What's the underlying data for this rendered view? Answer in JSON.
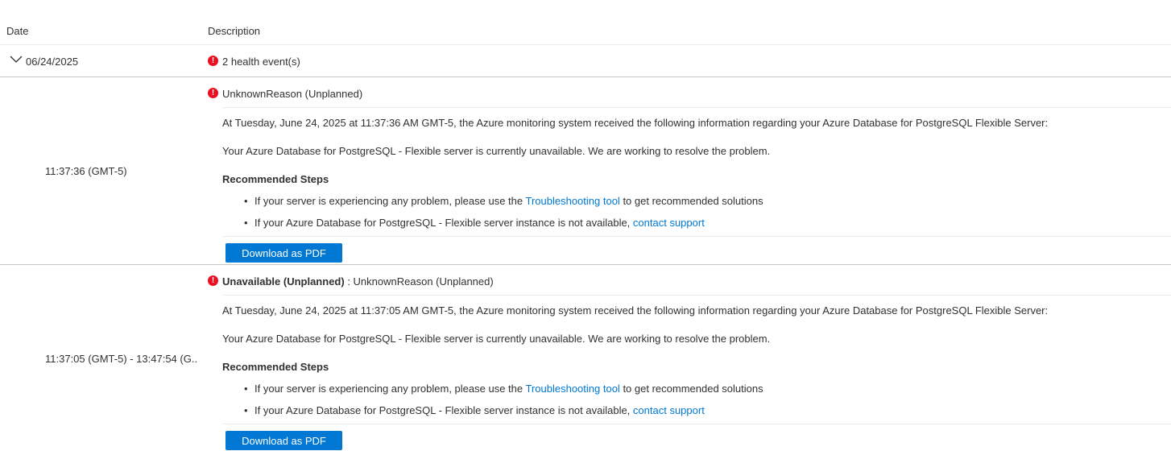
{
  "columns": {
    "date": "Date",
    "description": "Description"
  },
  "group": {
    "date": "06/24/2025",
    "summary": "2 health event(s)"
  },
  "events": [
    {
      "time": "11:37:36 (GMT-5)",
      "title_bold": "",
      "title": "UnknownReason (Unplanned)",
      "info": "At Tuesday, June 24, 2025 at 11:37:36 AM GMT-5, the Azure monitoring system received the following information regarding your Azure Database for PostgreSQL Flexible Server:",
      "status": "Your Azure Database for PostgreSQL - Flexible server is currently unavailable. We are working to resolve the problem.",
      "recommended_heading": "Recommended Steps",
      "steps": [
        {
          "before": "If your server is experiencing any problem, please use the ",
          "link": "Troubleshooting tool",
          "after": " to get recommended solutions"
        },
        {
          "before": "If your Azure Database for PostgreSQL - Flexible server instance is not available, ",
          "link": "contact support",
          "after": ""
        }
      ],
      "button": "Download as PDF"
    },
    {
      "time": "11:37:05 (GMT-5) - 13:47:54 (G...",
      "title_bold": "Unavailable (Unplanned)",
      "title": " : UnknownReason (Unplanned)",
      "info": "At Tuesday, June 24, 2025 at 11:37:05 AM GMT-5, the Azure monitoring system received the following information regarding your Azure Database for PostgreSQL Flexible Server:",
      "status": "Your Azure Database for PostgreSQL - Flexible server is currently unavailable. We are working to resolve the problem.",
      "recommended_heading": "Recommended Steps",
      "steps": [
        {
          "before": "If your server is experiencing any problem, please use the ",
          "link": "Troubleshooting tool",
          "after": " to get recommended solutions"
        },
        {
          "before": "If your Azure Database for PostgreSQL - Flexible server instance is not available, ",
          "link": "contact support",
          "after": ""
        }
      ],
      "button": "Download as PDF"
    }
  ],
  "icons": {
    "error": "error-circle-icon",
    "expand": "chevron-down-icon"
  },
  "colors": {
    "error": "#e81123",
    "link": "#0078d4",
    "button": "#0078d4"
  }
}
